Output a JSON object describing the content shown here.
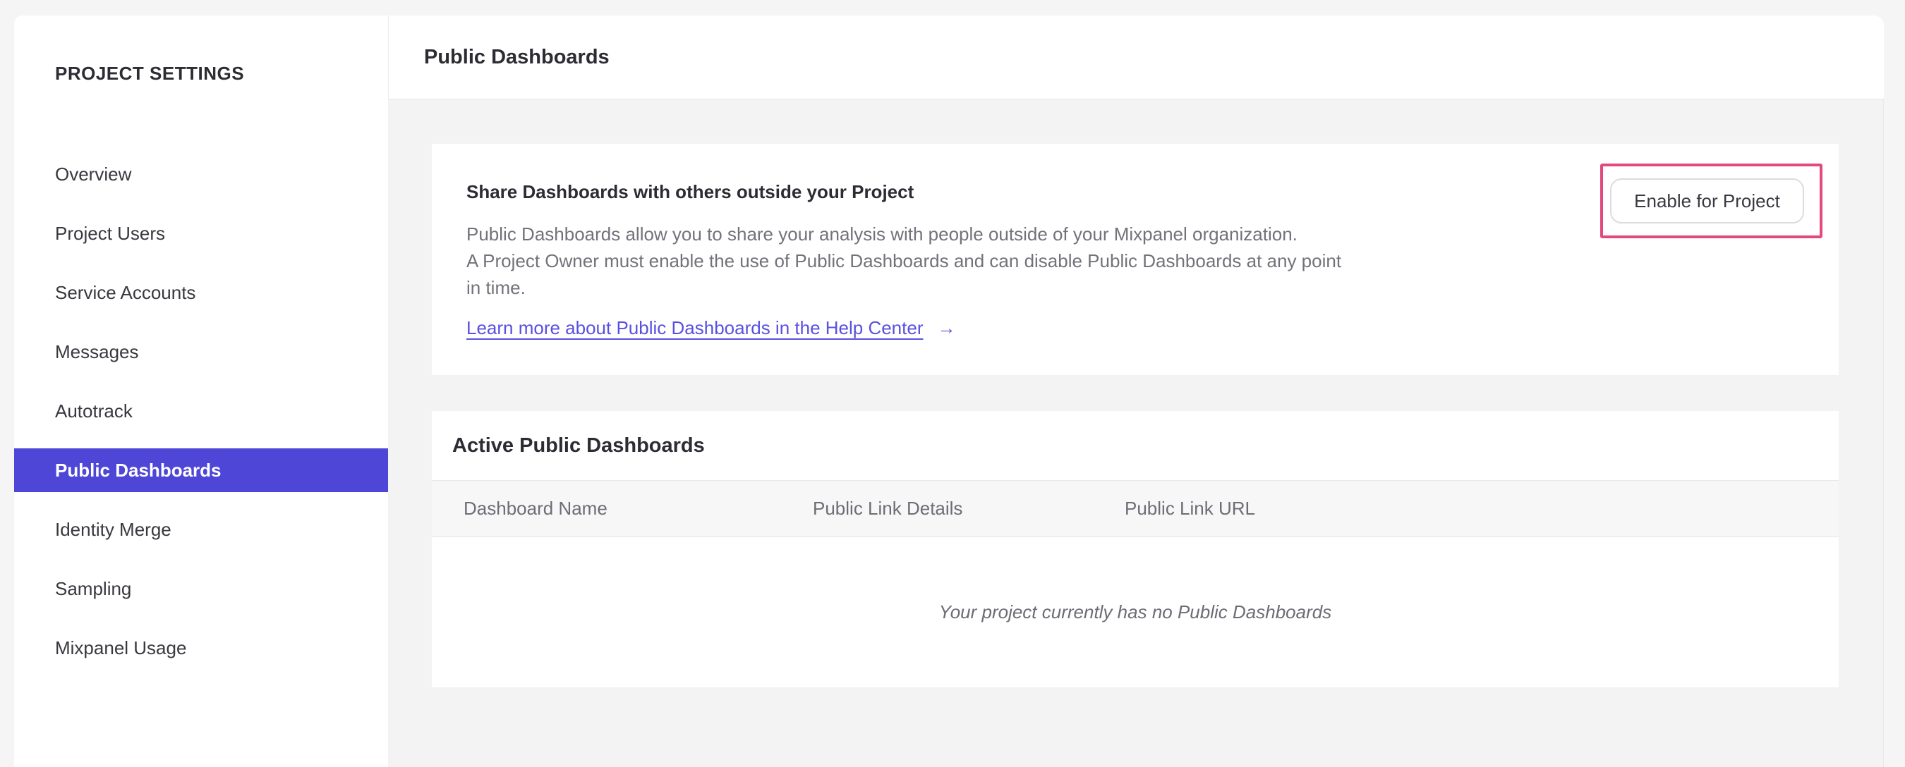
{
  "sidebar": {
    "title": "PROJECT SETTINGS",
    "items": [
      {
        "label": "Overview",
        "selected": false
      },
      {
        "label": "Project Users",
        "selected": false
      },
      {
        "label": "Service Accounts",
        "selected": false
      },
      {
        "label": "Messages",
        "selected": false
      },
      {
        "label": "Autotrack",
        "selected": false
      },
      {
        "label": "Public Dashboards",
        "selected": true
      },
      {
        "label": "Identity Merge",
        "selected": false
      },
      {
        "label": "Sampling",
        "selected": false
      },
      {
        "label": "Mixpanel Usage",
        "selected": false
      }
    ]
  },
  "header": {
    "title": "Public Dashboards"
  },
  "share_card": {
    "title": "Share Dashboards with others outside your Project",
    "description_lines": [
      "Public Dashboards allow you to share your analysis with people outside of your Mixpanel organization.",
      "A Project Owner must enable the use of Public Dashboards and can disable Public Dashboards at any point",
      "in time."
    ],
    "link_label": "Learn more about Public Dashboards in the Help Center",
    "link_arrow": "→",
    "enable_button_label": "Enable for Project"
  },
  "active_card": {
    "title": "Active Public Dashboards",
    "columns": [
      "Dashboard Name",
      "Public Link Details",
      "Public Link URL"
    ],
    "empty_message": "Your project currently has no Public Dashboards"
  },
  "colors": {
    "accent_purple": "#4e46d7",
    "link_purple": "#5a50e0",
    "highlight_pink": "#e2497f"
  }
}
